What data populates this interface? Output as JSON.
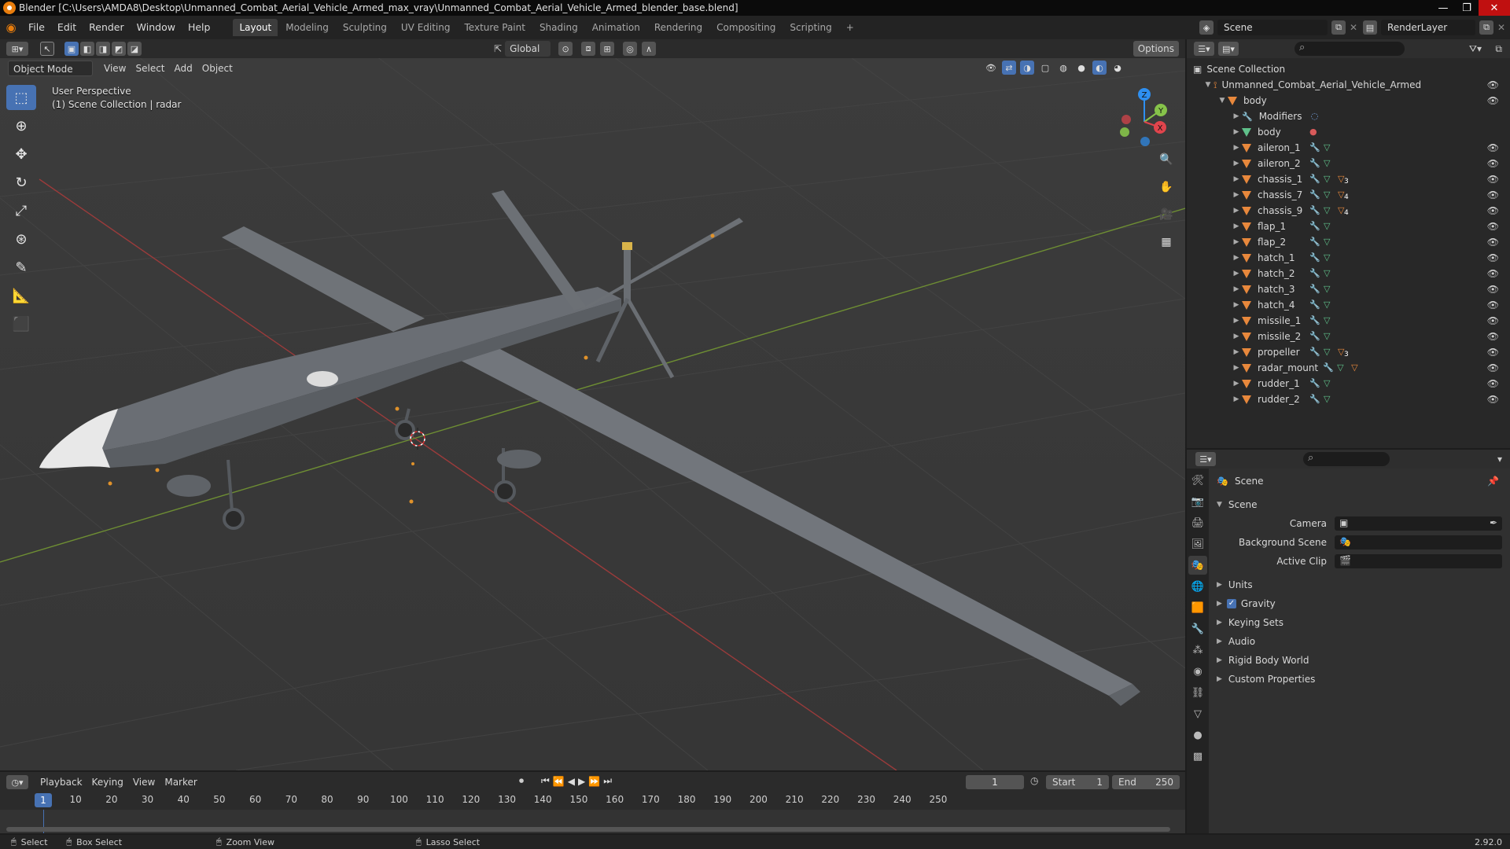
{
  "window": {
    "title": "Blender [C:\\Users\\AMDA8\\Desktop\\Unmanned_Combat_Aerial_Vehicle_Armed_max_vray\\Unmanned_Combat_Aerial_Vehicle_Armed_blender_base.blend]"
  },
  "menubar": {
    "menus": [
      "File",
      "Edit",
      "Render",
      "Window",
      "Help"
    ],
    "workspaces": [
      "Layout",
      "Modeling",
      "Sculpting",
      "UV Editing",
      "Texture Paint",
      "Shading",
      "Animation",
      "Rendering",
      "Compositing",
      "Scripting"
    ],
    "active_workspace": "Layout",
    "add_tab": "+",
    "scene_label": "Scene",
    "renderlayer_label": "RenderLayer"
  },
  "viewport": {
    "transform_orientation": "Global",
    "options_label": "Options",
    "mode": "Object Mode",
    "header_menus": [
      "View",
      "Select",
      "Add",
      "Object"
    ],
    "info_line1": "User Perspective",
    "info_line2": "(1) Scene Collection | radar"
  },
  "gizmo": {
    "x": "X",
    "y": "Y",
    "z": "Z",
    "x_color": "#e0444c",
    "y_color": "#86c34a",
    "z_color": "#2e8ff0"
  },
  "outliner": {
    "root": "Scene Collection",
    "collection": "Unmanned_Combat_Aerial_Vehicle_Armed",
    "parent": "body",
    "children": [
      {
        "name": "Modifiers",
        "kind": "modifiers"
      },
      {
        "name": "body",
        "kind": "mesh"
      },
      {
        "name": "aileron_1",
        "kind": "object"
      },
      {
        "name": "aileron_2",
        "kind": "object"
      },
      {
        "name": "chassis_1",
        "kind": "object",
        "badge": "3"
      },
      {
        "name": "chassis_7",
        "kind": "object",
        "badge": "4"
      },
      {
        "name": "chassis_9",
        "kind": "object",
        "badge": "4"
      },
      {
        "name": "flap_1",
        "kind": "object"
      },
      {
        "name": "flap_2",
        "kind": "object"
      },
      {
        "name": "hatch_1",
        "kind": "object"
      },
      {
        "name": "hatch_2",
        "kind": "object"
      },
      {
        "name": "hatch_3",
        "kind": "object"
      },
      {
        "name": "hatch_4",
        "kind": "object"
      },
      {
        "name": "missile_1",
        "kind": "object"
      },
      {
        "name": "missile_2",
        "kind": "object"
      },
      {
        "name": "propeller",
        "kind": "object",
        "badge": "3"
      },
      {
        "name": "radar_mount",
        "kind": "object",
        "badge": ""
      },
      {
        "name": "rudder_1",
        "kind": "object"
      },
      {
        "name": "rudder_2",
        "kind": "object"
      }
    ]
  },
  "properties": {
    "context": "Scene",
    "panel": "Scene",
    "fields": {
      "camera": "Camera",
      "background_scene": "Background Scene",
      "active_clip": "Active Clip"
    },
    "sections": [
      "Units",
      "Gravity",
      "Keying Sets",
      "Audio",
      "Rigid Body World",
      "Custom Properties"
    ],
    "gravity_checked": true
  },
  "timeline": {
    "menus": [
      "Playback",
      "Keying",
      "View",
      "Marker"
    ],
    "current_frame": "1",
    "start_label": "Start",
    "start_value": "1",
    "end_label": "End",
    "end_value": "250",
    "ticks": [
      "10",
      "20",
      "30",
      "40",
      "50",
      "60",
      "70",
      "80",
      "90",
      "100",
      "110",
      "120",
      "130",
      "140",
      "150",
      "160",
      "170",
      "180",
      "190",
      "200",
      "210",
      "220",
      "230",
      "240",
      "250"
    ],
    "cursor_label": "1"
  },
  "statusbar": {
    "select": "Select",
    "box_select": "Box Select",
    "zoom_view": "Zoom View",
    "lasso_select": "Lasso Select",
    "version": "2.92.0"
  }
}
